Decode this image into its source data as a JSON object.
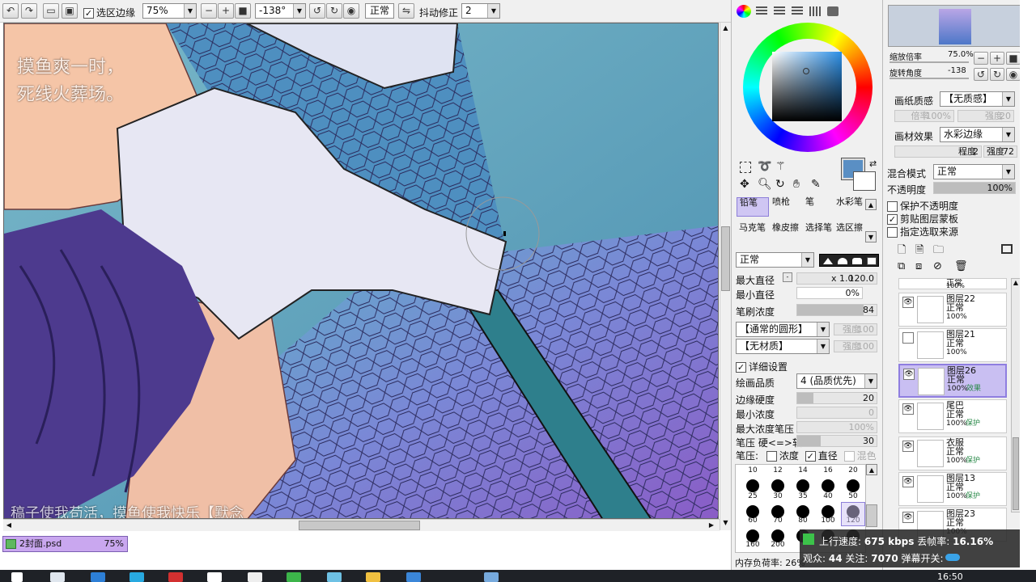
{
  "toolbar": {
    "select_edge_label": "选区边缘",
    "zoom_value": "75%",
    "rotation_value": "-138°",
    "blend_mode_value": "正常",
    "stabilizer_label": "抖动修正",
    "stabilizer_value": "2"
  },
  "canvas": {
    "overlay_line1": "摸鱼爽一时，",
    "overlay_line2": "死线火葬场。",
    "bottom_text": "稿子使我苟活，摸鱼使我快乐【默念"
  },
  "document_tab": {
    "filename": "2封面.psd",
    "zoom": "75%"
  },
  "navigator": {
    "zoom_label": "缩放倍率",
    "zoom_value": "75.0%",
    "rotate_label": "旋转角度",
    "rotate_value": "-138"
  },
  "paper": {
    "texture_label": "画纸质感",
    "texture_value": "【无质感】",
    "texture_scale": "倍率",
    "texture_scale_value": "100%",
    "texture_strength": "强度",
    "texture_strength_value": "20",
    "effect_label": "画材效果",
    "effect_value": "水彩边缘",
    "degree_label": "程度",
    "degree_value": "2",
    "strength_label": "强度",
    "strength_value": "72"
  },
  "layer_props": {
    "blend_label": "混合模式",
    "blend_value": "正常",
    "opacity_label": "不透明度",
    "opacity_value": "100%",
    "protect_opacity": "保护不透明度",
    "clip_mask": "剪贴图层蒙板",
    "selection_source": "指定选取来源"
  },
  "tools": {
    "row1": [
      "铅笔",
      "喷枪",
      "笔",
      "水彩笔"
    ],
    "row2": [
      "马克笔",
      "橡皮擦",
      "选择笔",
      "选区擦"
    ],
    "selected_index": 0
  },
  "brush": {
    "mode_value": "正常",
    "max_size_label": "最大直径",
    "max_size_mult": "x 1.0",
    "max_size_value": "120.0",
    "min_size_label": "最小直径",
    "min_size_value": "0%",
    "density_label": "笔刷浓度",
    "density_value": "84",
    "density_pct": 84,
    "shape_value": "【通常的圆形】",
    "shape_strength": "强度",
    "shape_strength_value": "100",
    "texture_value": "【无材质】",
    "texture_strength": "强度",
    "texture_strength_value": "100",
    "advanced_label": "详细设置",
    "quality_label": "绘画品质",
    "quality_value": "4 (品质优先)",
    "edge_label": "边缘硬度",
    "edge_value": "20",
    "edge_pct": 20,
    "min_density_label": "最小浓度",
    "min_density_value": "0",
    "max_density_label": "最大浓度笔压",
    "max_density_value": "100%",
    "pressure_label": "笔压  硬<=>软",
    "pressure_value": "30",
    "pressure_pct": 30,
    "pressure_row_label": "笔压:",
    "pressure_density": "浓度",
    "pressure_size": "直径",
    "pressure_blend": "混色"
  },
  "brush_sizes": {
    "top_row": [
      "10",
      "12",
      "14",
      "16",
      "20"
    ],
    "row2": [
      "25",
      "30",
      "35",
      "40",
      "50"
    ],
    "row3": [
      "60",
      "70",
      "80",
      "100",
      "120"
    ],
    "row4": [
      "160",
      "200"
    ],
    "selected": "120"
  },
  "memory_label": "内存负荷率: 26%",
  "layers": [
    {
      "name": "图层22",
      "mode": "正常",
      "opacity": "100%",
      "flag": "",
      "visible": true,
      "selected": false
    },
    {
      "name": "图层21",
      "mode": "正常",
      "opacity": "100%",
      "flag": "",
      "visible": false,
      "selected": false
    },
    {
      "name": "图层26",
      "mode": "正常",
      "opacity": "100%",
      "flag": "效果",
      "visible": true,
      "selected": true
    },
    {
      "name": "尾巴",
      "mode": "正常",
      "opacity": "100%",
      "flag": "保护",
      "visible": true,
      "selected": false
    },
    {
      "name": "衣服",
      "mode": "正常",
      "opacity": "100%",
      "flag": "保护",
      "visible": true,
      "selected": false
    },
    {
      "name": "图层13",
      "mode": "正常",
      "opacity": "100%",
      "flag": "保护",
      "visible": true,
      "selected": false
    },
    {
      "name": "图层23",
      "mode": "正常",
      "opacity": "100%",
      "flag": "",
      "visible": true,
      "selected": false
    }
  ],
  "layer_top_partial": {
    "mode": "正常",
    "opacity": "100%"
  },
  "stream": {
    "upload_label": "上行速度:",
    "upload_value": "675 kbps",
    "drop_label": "丢帧率:",
    "drop_value": "16.16%",
    "viewers_label": "观众:",
    "viewers_value": "44",
    "follow_label": "关注:",
    "follow_value": "7070",
    "danmaku_label": "弹幕开关:"
  },
  "clock": "16:50",
  "colors": {
    "accent": "#8f7ee0",
    "current_color": "#5a8fc4",
    "canvas_bg": "#6fb0c3"
  }
}
